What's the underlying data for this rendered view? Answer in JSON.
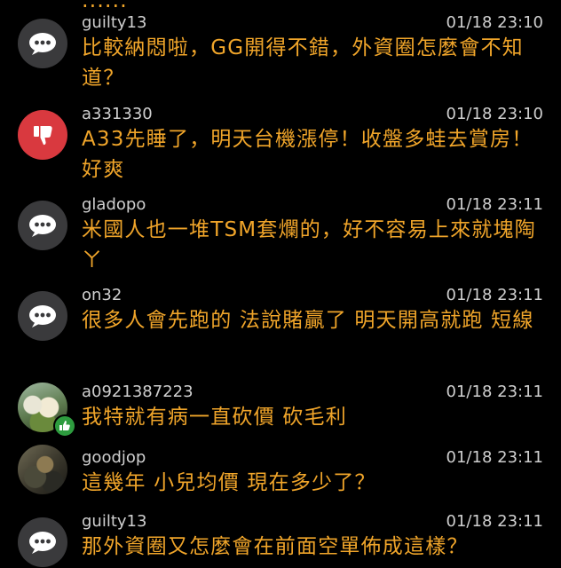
{
  "feed": {
    "cut_text": "......",
    "comments": [
      {
        "username": "guilty13",
        "time": "01/18 23:10",
        "text": "比較納悶啦，GG開得不錯，外資圈怎麼會不知道？",
        "avatar": "chat-bubble-icon"
      },
      {
        "username": "a331330",
        "time": "01/18 23:10",
        "text": "A33先睡了，明天台機漲停！收盤多蛙去賞房！好爽",
        "avatar": "thumbs-down-icon"
      },
      {
        "username": "gladopo",
        "time": "01/18 23:11",
        "text": "米國人也一堆TSM套爛的，好不容易上來就塊陶ㄚ",
        "avatar": "chat-bubble-icon"
      },
      {
        "username": "on32",
        "time": "01/18 23:11",
        "text": "很多人會先跑的 法說賭贏了 明天開高就跑 短線",
        "avatar": "chat-bubble-icon"
      },
      {
        "username": "a0921387223",
        "time": "01/18 23:11",
        "text": "我特就有病一直砍價 砍毛利",
        "avatar": "photo-avatar-with-like-badge"
      },
      {
        "username": "goodjop",
        "time": "01/18 23:11",
        "text": "這幾年 小兒均價 現在多少了？",
        "avatar": "photo-avatar"
      },
      {
        "username": "guilty13",
        "time": "01/18 23:11",
        "text": "那外資圈又怎麼會在前面空單佈成這樣？",
        "avatar": "chat-bubble-icon"
      }
    ]
  },
  "colors": {
    "background": "#000000",
    "comment_text": "#f0a52a",
    "meta_text": "#cfcfcf",
    "chat_avatar": "#3a3a3c",
    "downvote_avatar": "#d9393f",
    "like_badge": "#2e9c3f"
  }
}
